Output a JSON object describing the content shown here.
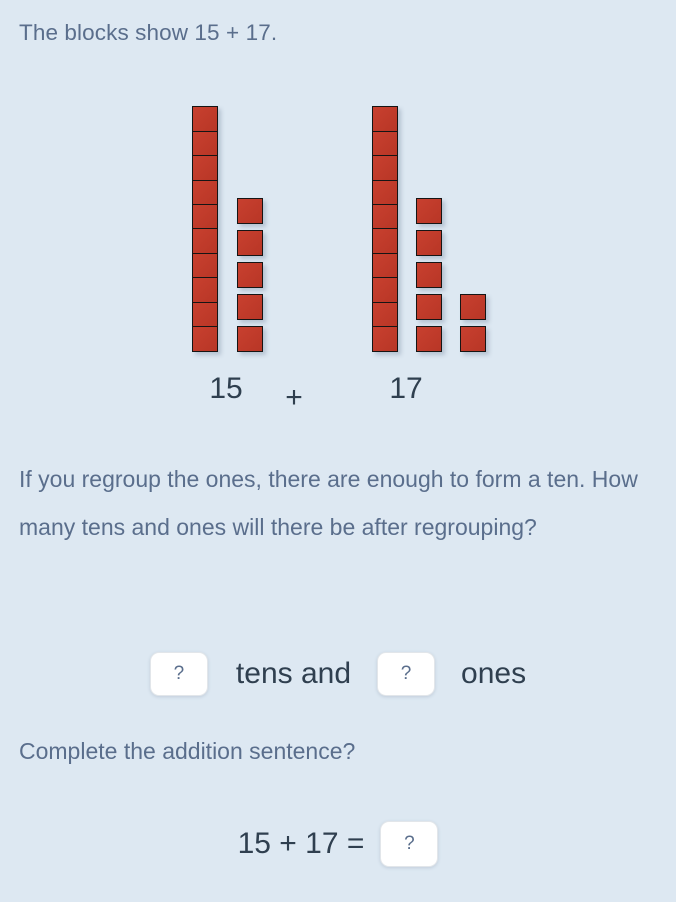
{
  "prompt": {
    "header": "The blocks show 15 + 17.",
    "question": "If you regroup the ones, there are enough to form a ten. How many tens and ones will there be after regrouping?",
    "sentence_prompt": "Complete the addition sentence?"
  },
  "blocks_diagram": {
    "operator": "+",
    "block_color": "#c0392b",
    "block_border_color": "#151515",
    "groups": [
      {
        "label": "15",
        "tens": 1,
        "ones": 5,
        "columns": [
          {
            "type": "tens-rod",
            "count": 10
          },
          {
            "type": "ones-column",
            "count": 5
          }
        ]
      },
      {
        "label": "17",
        "tens": 1,
        "ones": 7,
        "columns": [
          {
            "type": "tens-rod",
            "count": 10
          },
          {
            "type": "ones-column",
            "count": 5
          },
          {
            "type": "ones-column",
            "count": 2
          }
        ]
      }
    ]
  },
  "regroup_answer": {
    "tens_input": {
      "value": "?"
    },
    "tens_label": "tens and",
    "ones_input": {
      "value": "?"
    },
    "ones_label": "ones"
  },
  "equation": {
    "text": "15 + 17  =",
    "result_input": {
      "value": "?"
    }
  },
  "theme": {
    "background": "#dde8f2",
    "body_text": "#5a6e8c",
    "number_text": "#2f3f4f",
    "input_background": "#ffffff"
  }
}
